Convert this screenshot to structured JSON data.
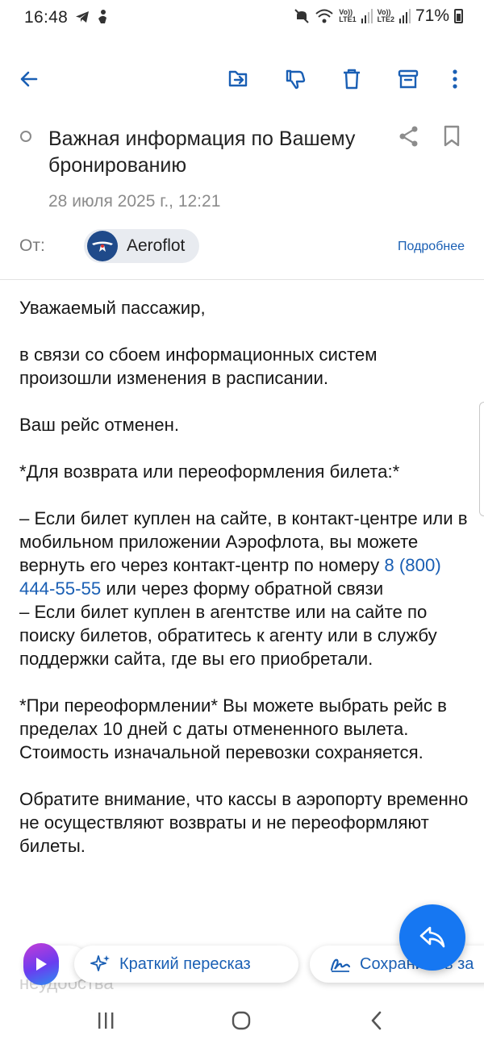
{
  "status_bar": {
    "time": "16:48",
    "lte1": "LTE1",
    "lte2": "LTE2",
    "vo": "Vo))",
    "battery": "71%"
  },
  "toolbar": {
    "icons": [
      "back-arrow-icon",
      "move-icon",
      "thumb-down-icon",
      "trash-icon",
      "archive-icon",
      "more-vert-icon"
    ]
  },
  "message": {
    "subject": "Важная информация по Вашему бронированию",
    "date": "28 июля 2025 г., 12:21",
    "from_label": "От:",
    "sender": "Aeroflot",
    "details": "Подробнее"
  },
  "body": {
    "greeting": "Уважаемый пассажир,",
    "p1": "в связи со сбоем информационных систем произошли изменения в расписании.",
    "p2": "Ваш рейс отменен.",
    "p3": "*Для возврата или переоформления билета:*",
    "p4_part1": "– Если билет куплен на сайте, в контакт-центре или в мобильном приложении Аэрофлота, вы можете вернуть его через контакт-центр по номеру ",
    "phone": "8 (800) 444-55-55",
    "p4_part2": " или через форму обратной связи",
    "p5": "– Если билет куплен в агентстве или на сайте по поиску билетов, обратитесь к агенту или в службу поддержки сайта, где вы его приобретали.",
    "p6": "*При переоформлении* Вы можете выбрать рейс в пределах 10 дней с даты отмененного вылета. Стоимость изначальной перевозки сохраняется.",
    "p7": "Обратите внимание, что кассы в аэропорту временно не осуществляют возвраты и не переоформляют билеты.",
    "faded": "неудобства"
  },
  "actions": {
    "summary": "Краткий пересказ",
    "save": "Сохранить в за"
  },
  "colors": {
    "accent": "#1a5fb4",
    "fab": "#1677f2",
    "aeroflot_blue": "#1f4a8a"
  }
}
